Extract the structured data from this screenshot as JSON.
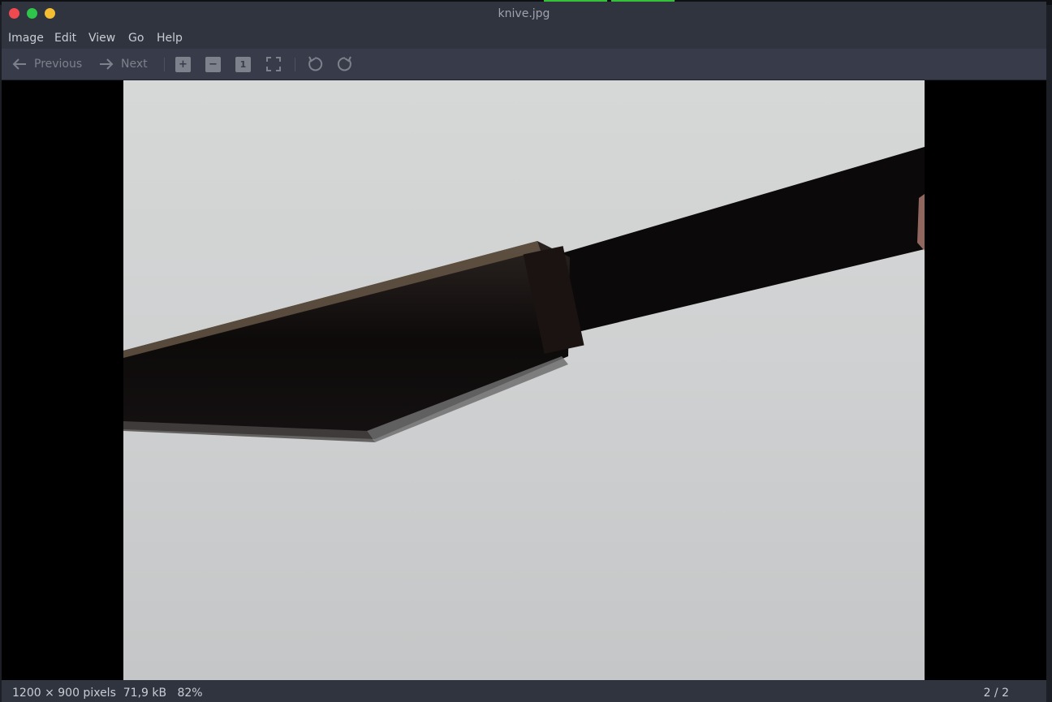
{
  "window": {
    "title": "knive.jpg"
  },
  "menu": [
    "Image",
    "Edit",
    "View",
    "Go",
    "Help"
  ],
  "toolbar": {
    "previous_label": "Previous",
    "next_label": "Next",
    "zoom_in_icon": "plus-icon",
    "zoom_out_icon": "minus-icon",
    "actual_size_icon": "one-to-one-icon",
    "fit_icon": "fullscreen-icon",
    "rotate_left_icon": "rotate-left-icon",
    "rotate_right_icon": "rotate-right-icon"
  },
  "status": {
    "dimensions": "1200 × 900 pixels",
    "size": "71,9 kB",
    "zoom": "82%",
    "position": "2 / 2"
  },
  "colors": {
    "titlebar": "#2f343f",
    "toolbar": "#383c4a",
    "close": "#f04a50",
    "maximize": "#2fc54a",
    "minimize": "#f5bd32"
  }
}
